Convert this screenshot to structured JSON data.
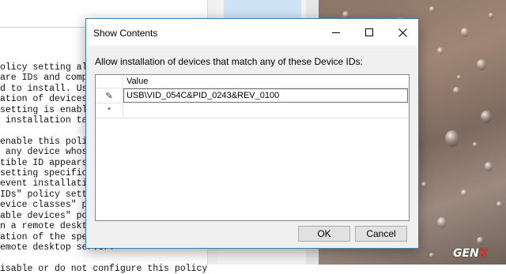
{
  "background_text": {
    "lines": [
      "olicy setting allows you to",
      "are IDs and compatible ID",
      "d to install. Use this policy",
      "ation of devices not descr",
      "setting is enabled. Other",
      " installation take precede",
      "",
      "enable this policy setting,",
      " any device whose Plug a",
      "tible ID appears in the lis",
      "setting specifically preve",
      "event installation of devi",
      "IDs\" policy setting, the \"",
      "evice classes\" policy set",
      "able devices\" policy setti",
      "n a remote desktop serv",
      "ation of the specified dev",
      "emote desktop server.",
      "",
      "isable or do not configure this policy setting, and no"
    ]
  },
  "dialog": {
    "title": "Show Contents",
    "instruction": "Allow installation of devices that match any of these Device IDs:",
    "column_header": "Value",
    "rows": [
      {
        "marker": "✎",
        "value": "USB\\VID_054C&PID_0243&REV_0100"
      },
      {
        "marker": "*",
        "value": ""
      }
    ],
    "ok_label": "OK",
    "cancel_label": "Cancel"
  },
  "watermark": {
    "text": "GEN",
    "accent": "K"
  },
  "icons": [
    "minimize-icon",
    "maximize-icon",
    "close-icon",
    "edit-pencil-icon",
    "new-row-asterisk-icon"
  ],
  "colors": {
    "dialog_border": "#3c7fb1",
    "button_face": "#e1e1e1",
    "watermark_accent": "#e03c2c"
  }
}
